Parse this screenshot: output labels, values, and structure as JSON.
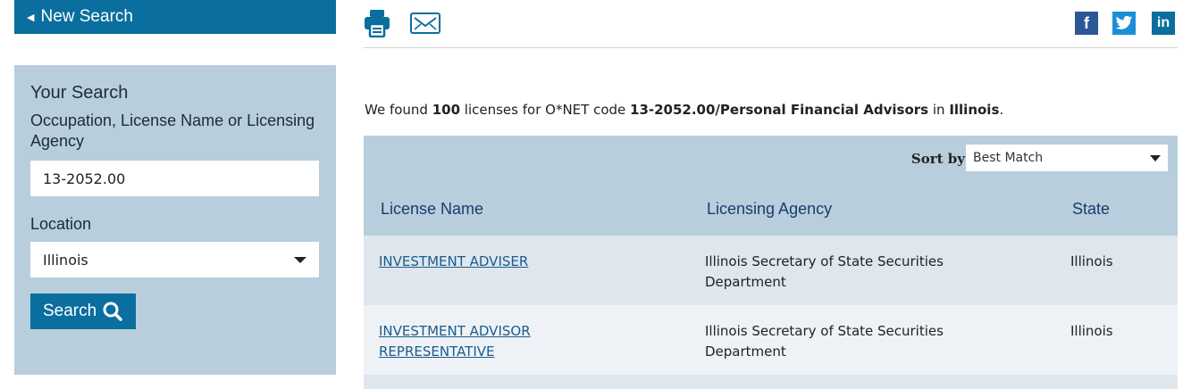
{
  "sidebar": {
    "new_search_label": "New Search",
    "title": "Your Search",
    "occupation_label": "Occupation, License Name or Licensing Agency",
    "occupation_value": "13-2052.00",
    "location_label": "Location",
    "location_value": "Illinois",
    "search_button_label": "Search"
  },
  "toolbar": {
    "icons": [
      "print-icon",
      "email-icon",
      "facebook-icon",
      "twitter-icon",
      "linkedin-icon"
    ],
    "facebook_glyph": "f",
    "linkedin_glyph": "in"
  },
  "summary": {
    "prefix": "We found ",
    "count": "100",
    "middle": " licenses for O*NET code ",
    "code": "13-2052.00/Personal Financial Advisors",
    "in": " in ",
    "state": "Illinois",
    "suffix": "."
  },
  "results": {
    "sort_label": "Sort by",
    "sort_value": "Best Match",
    "columns": [
      "License Name",
      "Licensing Agency",
      "State"
    ],
    "rows": [
      {
        "license_name": "INVESTMENT ADVISER",
        "agency": "Illinois Secretary of State Securities Department",
        "state": "Illinois"
      },
      {
        "license_name": "INVESTMENT ADVISOR REPRESENTATIVE",
        "agency": "Illinois Secretary of State Securities Department",
        "state": "Illinois"
      }
    ]
  },
  "colors": {
    "accent": "#0a6e9e",
    "panel": "#b8cedc",
    "header_text": "#1a3c6e",
    "row_odd": "#dfe6ee",
    "row_even": "#eef2f6"
  }
}
